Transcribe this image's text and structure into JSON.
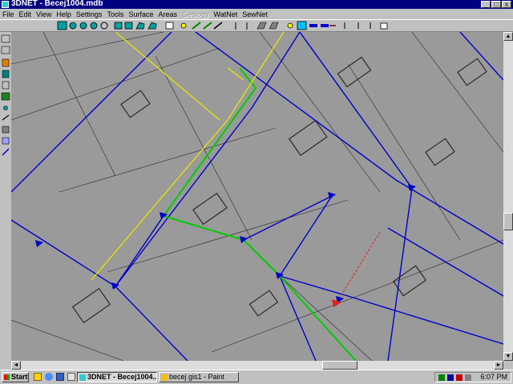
{
  "window": {
    "title": "3DNET - Becej1004.mdb",
    "minimize_label": "_",
    "maximize_label": "□",
    "close_label": "x"
  },
  "menu": [
    "File",
    "Edit",
    "View",
    "Help",
    "Settings",
    "Tools",
    "Surface",
    "Areas",
    "Geology",
    "WatNet",
    "SewNet"
  ],
  "menu_disabled": [
    false,
    false,
    false,
    false,
    false,
    false,
    false,
    false,
    true,
    false,
    false
  ],
  "toolbar": {
    "icons": [
      "select-icon",
      "zoom-in-icon",
      "zoom-out-icon",
      "zoom-window-icon",
      "pan-icon",
      "refresh-icon",
      "layers-icon",
      "polygon-icon",
      "edit-polygon-icon",
      "copy-icon",
      "node-icon",
      "pipe-icon",
      "link-icon",
      "measure-icon",
      "point-icon",
      "split-icon",
      "area-icon",
      "profile-icon",
      "node-yellow-icon",
      "pipe-select-icon",
      "valve-icon",
      "pump-icon",
      "label-icon",
      "pipe-label-icon",
      "flow-label-icon",
      "section-icon",
      "print-icon"
    ]
  },
  "left_tools": [
    "coordinates-icon",
    "grid-icon",
    "layer-color-icon",
    "mosaic-icon",
    "map-icon",
    "raster-icon",
    "point-tool-icon",
    "line-tool-icon",
    "hatch-tool-icon",
    "contour-tool-icon",
    "network-tool-icon"
  ],
  "map": {
    "colors": {
      "background": "#9a9a9a",
      "water": "#0000cc",
      "sewer": "#00cc00",
      "storm": "#e6e600",
      "proposed": "#dd2222",
      "linework": "#2a2a2a"
    }
  },
  "scroll": {
    "up": "▲",
    "down": "▼",
    "left": "◄",
    "right": "►"
  },
  "taskbar": {
    "start_label": "Start",
    "tasks": [
      {
        "label": "3DNET - Becej1004....",
        "active": true
      },
      {
        "label": "becej gis1 - Paint",
        "active": false
      }
    ],
    "clock": "6:07 PM"
  }
}
